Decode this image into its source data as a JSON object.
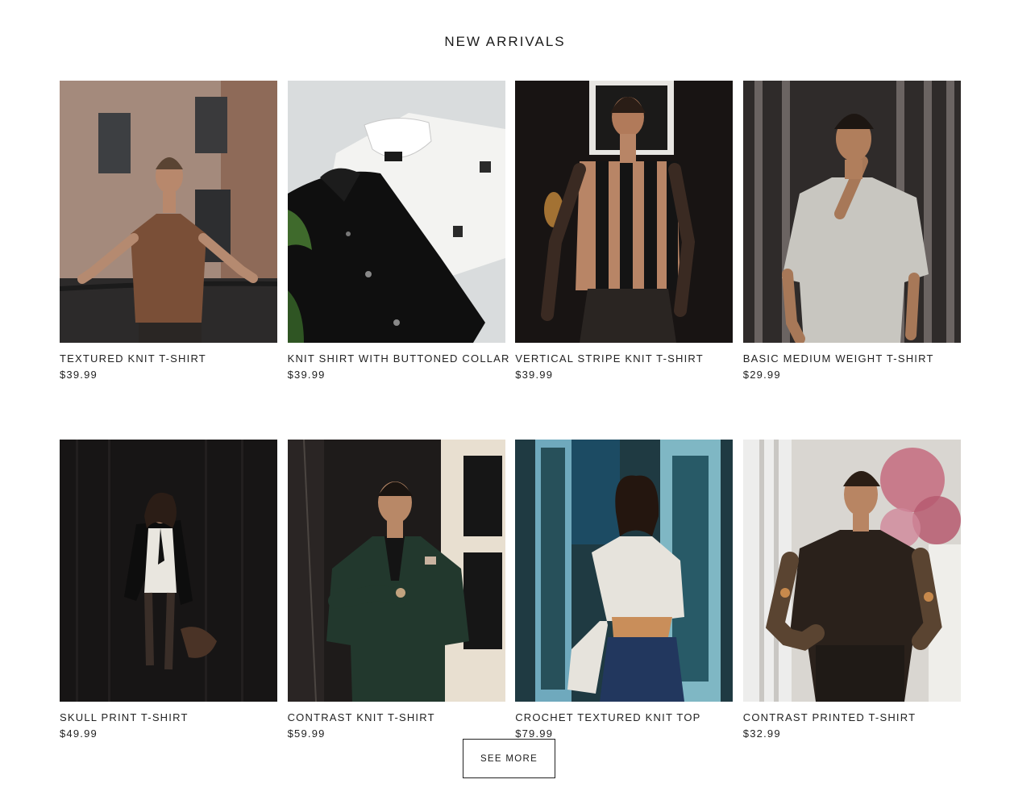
{
  "section": {
    "title": "NEW ARRIVALS"
  },
  "products": [
    {
      "name": "TEXTURED KNIT T-SHIRT",
      "price": "$39.99",
      "image": "man-brown-knit-shirt-balcony-photo"
    },
    {
      "name": "KNIT SHIRT WITH BUTTONED COLLAR",
      "price": "$39.99",
      "image": "black-and-white-shirts-flatlay-photo"
    },
    {
      "name": "VERTICAL STRIPE KNIT T-SHIRT",
      "price": "$39.99",
      "image": "woman-striped-top-photo"
    },
    {
      "name": "BASIC MEDIUM WEIGHT T-SHIRT",
      "price": "$29.99",
      "image": "man-grey-tshirt-photo"
    },
    {
      "name": "SKULL PRINT T-SHIRT",
      "price": "$49.99",
      "image": "woman-dark-curtain-photo"
    },
    {
      "name": "CONTRAST KNIT T-SHIRT",
      "price": "$59.99",
      "image": "man-green-suit-photo"
    },
    {
      "name": "CROCHET TEXTURED KNIT TOP",
      "price": "$79.99",
      "image": "woman-crochet-top-photo"
    },
    {
      "name": "CONTRAST PRINTED T-SHIRT",
      "price": "$32.99",
      "image": "man-printed-shirt-photo"
    }
  ],
  "actions": {
    "see_more_label": "SEE MORE"
  }
}
